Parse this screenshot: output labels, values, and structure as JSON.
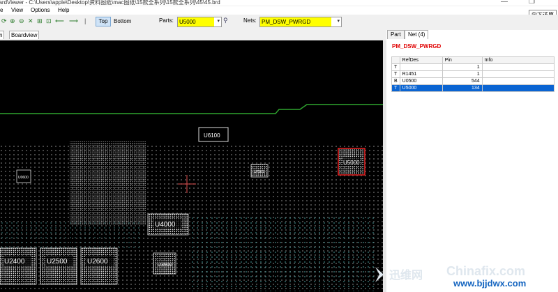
{
  "window": {
    "title": "oardViewer - C:\\Users\\apple\\Desktop\\资料图纸\\mac图纸\\15款全系列\\15款全系列\\45\\45.brd",
    "tooltip": "向下还原"
  },
  "menu": [
    "e",
    "View",
    "Options",
    "Help"
  ],
  "toolbar": {
    "top_label": "Top",
    "bottom_label": "Bottom",
    "parts_label": "Parts:",
    "parts_value": "U5000",
    "nets_label": "Nets:",
    "nets_value": "PM_DSW_PWRGD"
  },
  "tabs": [
    "n",
    "Boardview"
  ],
  "board": {
    "components": [
      {
        "label": "U6100"
      },
      {
        "label": "U5000"
      },
      {
        "label": "U4000"
      },
      {
        "label": "U2400"
      },
      {
        "label": "U2500"
      },
      {
        "label": "U2600"
      },
      {
        "label": "U3900"
      },
      {
        "label": "U7501"
      },
      {
        "label": "U0600"
      }
    ]
  },
  "panel": {
    "tabs": [
      "Part",
      "Net (4)"
    ],
    "net_title": "PM_DSW_PWRGD",
    "columns": [
      "",
      "RefDes",
      "Pin",
      "Info"
    ],
    "rows": [
      {
        "side": "T",
        "refdes": "",
        "pin": "1",
        "info": ""
      },
      {
        "side": "T",
        "refdes": "R1451",
        "pin": "1",
        "info": ""
      },
      {
        "side": "B",
        "refdes": "U0500",
        "pin": "544",
        "info": ""
      },
      {
        "side": "T",
        "refdes": "U5000",
        "pin": "134",
        "info": ""
      }
    ]
  },
  "watermark": {
    "text1": "迅维网",
    "text2": "Chinafix.com",
    "text3": "www.bjjdwx.com"
  },
  "colors": {
    "board_bg": "#000000",
    "trace": "#2fa52f",
    "highlight": "#ffff00",
    "selected": "#e02020",
    "net_title": "#e00000"
  }
}
